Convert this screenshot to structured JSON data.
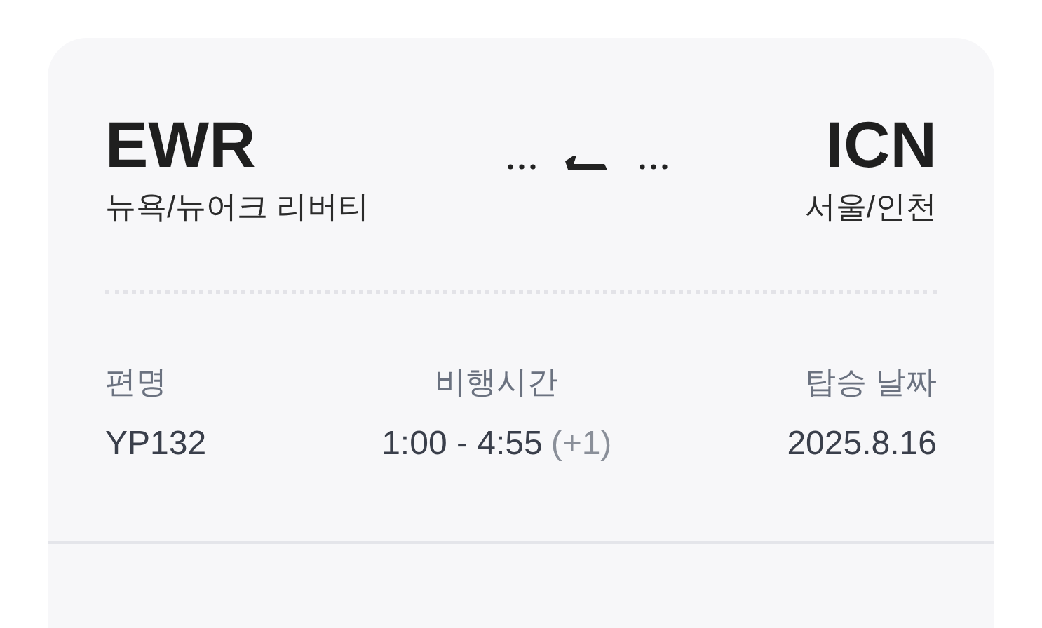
{
  "route": {
    "departure": {
      "code": "EWR",
      "city": "뉴욕/뉴어크 리버티"
    },
    "arrival": {
      "code": "ICN",
      "city": "서울/인천"
    }
  },
  "details": [
    {
      "label": "편명",
      "value": "YP132"
    },
    {
      "label": "비행시간",
      "value": "1:00 - 4:55",
      "day_offset": "(+1)"
    },
    {
      "label": "탑승 날짜",
      "value": "2025.8.16"
    }
  ]
}
